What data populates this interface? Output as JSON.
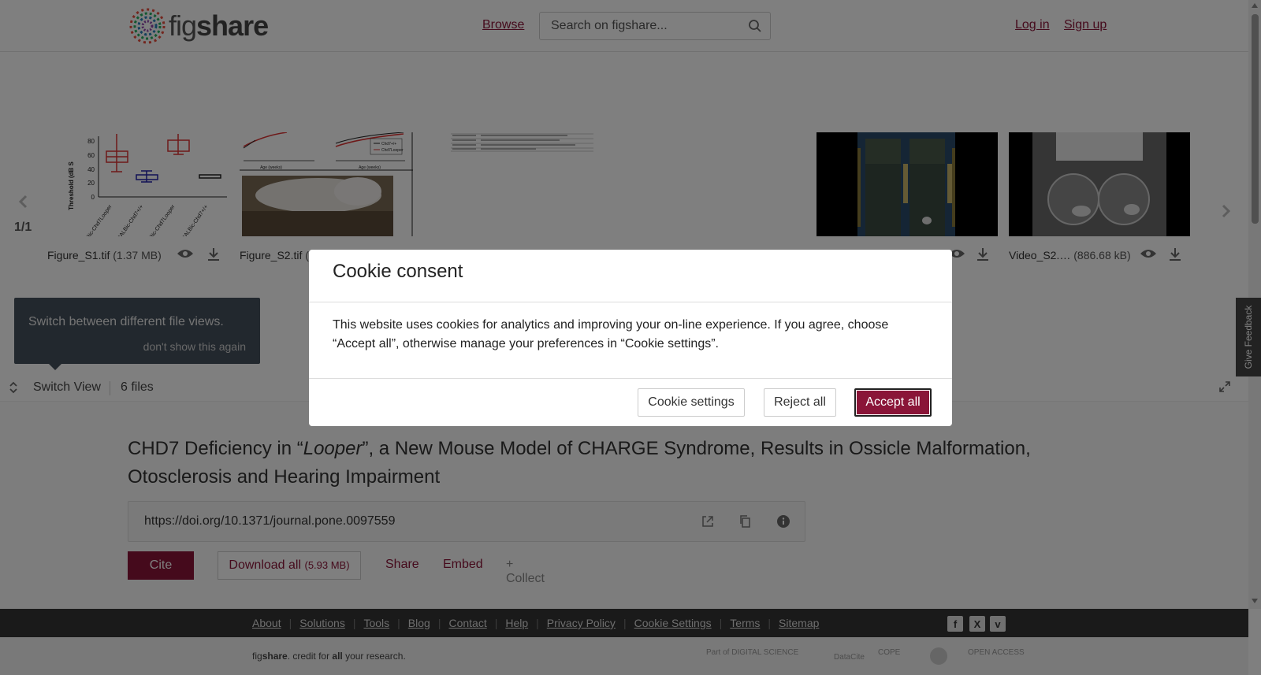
{
  "header": {
    "logo_text_light": "fig",
    "logo_text_bold": "share",
    "browse": "Browse",
    "search_placeholder": "Search on figshare...",
    "login": "Log in",
    "signup": "Sign up"
  },
  "carousel": {
    "counter": "1/1",
    "files": [
      {
        "name": "Figure_S1.tif",
        "size": "(1.37 MB)"
      },
      {
        "name": "Figure_S2.tif",
        "size": "("
      },
      {
        "name": "",
        "size": ""
      },
      {
        "name": "",
        "size": ""
      },
      {
        "name": "",
        "size": ""
      },
      {
        "name": "Video_S2.…",
        "size": "(886.68 kB)"
      }
    ],
    "thumb1": {
      "ylabel": "Threshold (dB S",
      "yticks": [
        "80",
        "60",
        "40",
        "20",
        "0"
      ],
      "xlabels": [
        "BALBic-Chd7Looper",
        "BALBic-Chd7+/+",
        "BALBic-Chd7Looper",
        "BALBic-Chd7+/+"
      ]
    },
    "thumb2": {
      "xlabel": "Age (weeks)",
      "legend": [
        "Chd7+/+",
        "Chd7Looper"
      ]
    }
  },
  "tooltip": {
    "text": "Switch between different file views.",
    "dismiss": "don't show this again"
  },
  "viewbar": {
    "switch_view": "Switch View",
    "file_count": "6 files"
  },
  "item": {
    "title_part1": "CHD7 Deficiency in “",
    "title_italic": "Looper",
    "title_part2": "”, a New Mouse Model of CHARGE Syndrome, Results in Ossicle Malformation, Otosclerosis and Hearing Impairment",
    "doi": "https://doi.org/10.1371/journal.pone.0097559",
    "cite": "Cite",
    "download_all": "Download all",
    "download_size": "(5.93 MB)",
    "share": "Share",
    "embed": "Embed",
    "collect": "+ Collect"
  },
  "footer": {
    "links": [
      "About",
      "Solutions",
      "Tools",
      "Blog",
      "Contact",
      "Help",
      "Privacy Policy",
      "Cookie Settings",
      "Terms",
      "Sitemap"
    ],
    "social": [
      "f",
      "X",
      "v"
    ],
    "tagline_pre": "fig",
    "tagline_bold": "share",
    "tagline_mid": ". credit for ",
    "tagline_all": "all",
    "tagline_end": " your research.",
    "partners": [
      "Part of DIGITAL SCIENCE",
      "DataCite",
      "COPE",
      "",
      "OPEN ACCESS"
    ]
  },
  "feedback": "Give Feedback",
  "cookie_modal": {
    "title": "Cookie consent",
    "body": "This website uses cookies for analytics and improving your on-line experience. If you agree, choose “Accept all”, otherwise manage your preferences in “Cookie settings”.",
    "settings": "Cookie settings",
    "reject": "Reject all",
    "accept": "Accept all"
  },
  "colors": {
    "brand": "#8a1538",
    "footer_dark": "#343434",
    "tooltip_bg": "#45505c"
  }
}
